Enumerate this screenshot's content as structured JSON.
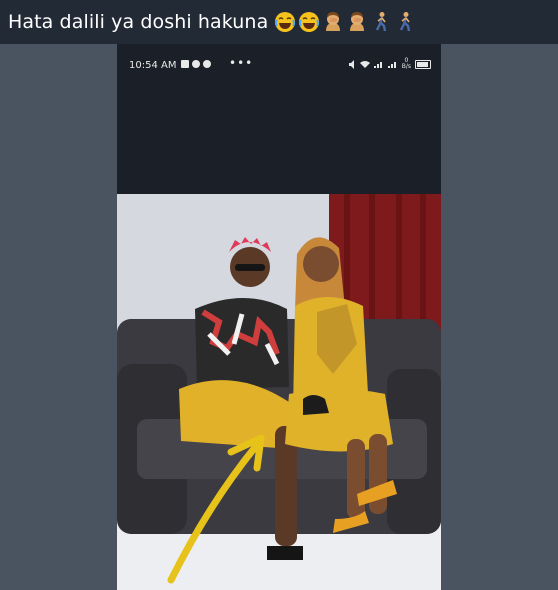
{
  "caption": {
    "text": "Hata dalili ya doshi hakuna",
    "emojis": [
      "face-with-tears-of-joy-icon",
      "face-with-tears-of-joy-icon",
      "woman-facepalming-icon",
      "woman-facepalming-icon",
      "man-walking-icon",
      "man-walking-icon"
    ]
  },
  "status_bar": {
    "time": "10:54 AM",
    "menu_dots": "•••",
    "net_speed_value": "0",
    "net_speed_unit": "B/s"
  },
  "photo": {
    "description_icon": "couple-photo",
    "arrow_color": "#e6c21a",
    "dress_color": "#e0b22a",
    "curtain_color": "#8a1c1c"
  }
}
